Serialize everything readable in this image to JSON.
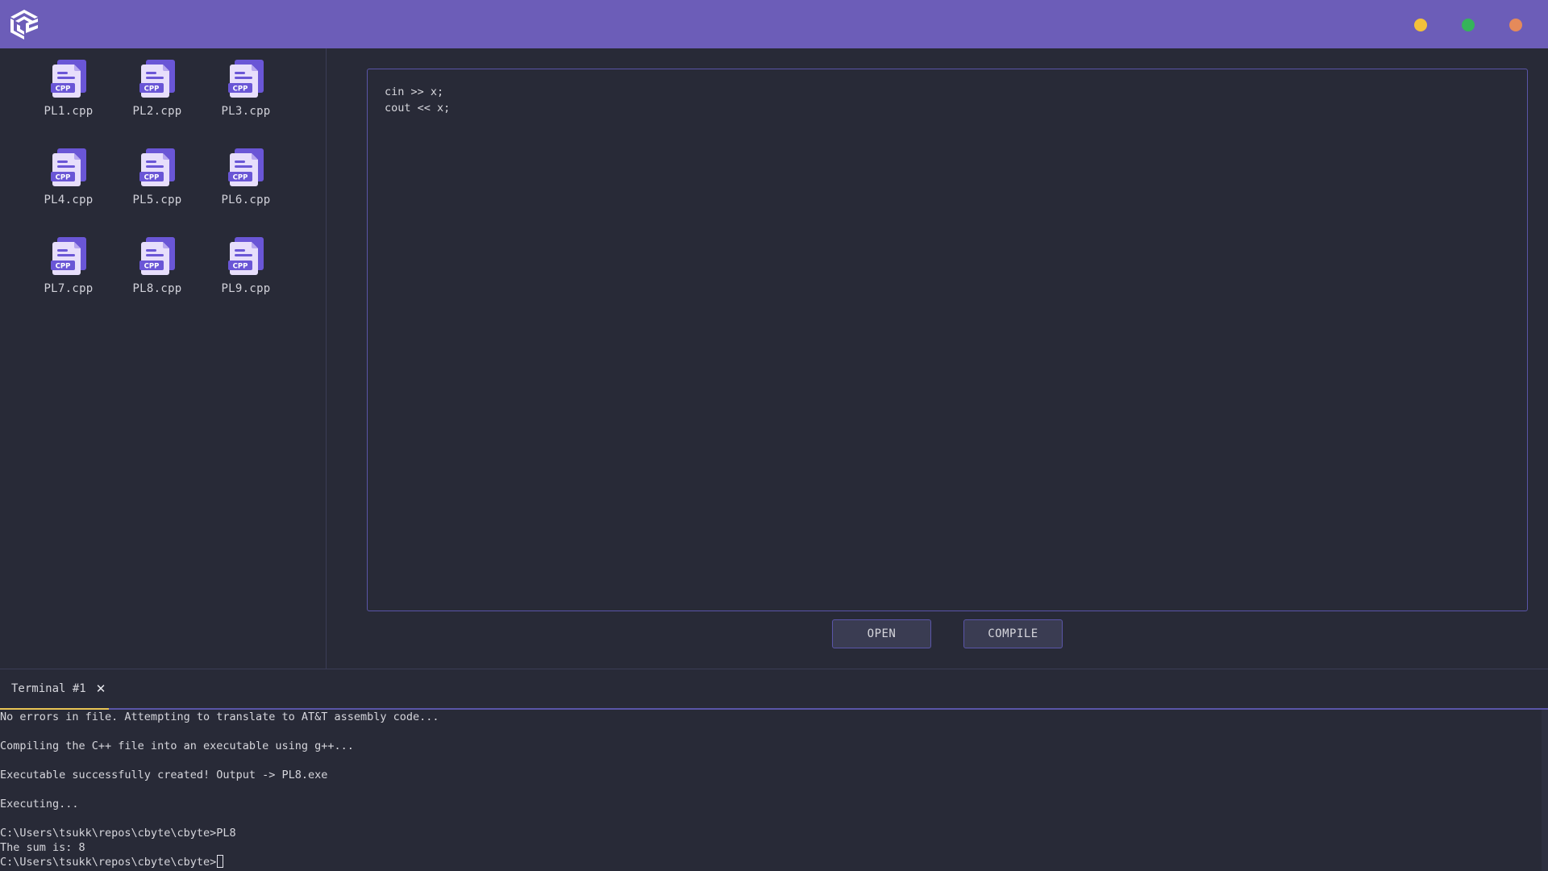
{
  "colors": {
    "titlebar": "#6c5db8",
    "accent": "#5a55a8",
    "minimize": "#f3c13a",
    "maximize": "#35b45a",
    "close": "#e58a5a",
    "tab_indicator": "#e8c454"
  },
  "window_controls": {
    "minimize_icon": "yellow-circle",
    "maximize_icon": "green-circle",
    "close_icon": "orange-circle"
  },
  "files": [
    {
      "name": "PL1.cpp",
      "badge": "CPP"
    },
    {
      "name": "PL2.cpp",
      "badge": "CPP"
    },
    {
      "name": "PL3.cpp",
      "badge": "CPP"
    },
    {
      "name": "PL4.cpp",
      "badge": "CPP"
    },
    {
      "name": "PL5.cpp",
      "badge": "CPP"
    },
    {
      "name": "PL6.cpp",
      "badge": "CPP"
    },
    {
      "name": "PL7.cpp",
      "badge": "CPP"
    },
    {
      "name": "PL8.cpp",
      "badge": "CPP"
    },
    {
      "name": "PL9.cpp",
      "badge": "CPP"
    }
  ],
  "editor": {
    "content": "cin >> x;\ncout << x;"
  },
  "buttons": {
    "open": "OPEN",
    "compile": "COMPILE"
  },
  "terminal": {
    "tab_label": "Terminal #1",
    "tab_close": "✕",
    "lines": [
      {
        "text": "No errors in file. Attempting to translate to AT&T assembly code...",
        "gap": true
      },
      {
        "text": "Compiling the C++ file into an executable using g++...",
        "gap": true
      },
      {
        "text": "Executable successfully created! Output -> PL8.exe",
        "gap": true
      },
      {
        "text": "Executing...",
        "gap": true
      },
      {
        "text": "C:\\Users\\tsukk\\repos\\cbyte\\cbyte>PL8",
        "gap": false
      },
      {
        "text": "The sum is: 8",
        "gap": false
      }
    ],
    "prompt": "C:\\Users\\tsukk\\repos\\cbyte\\cbyte>"
  }
}
